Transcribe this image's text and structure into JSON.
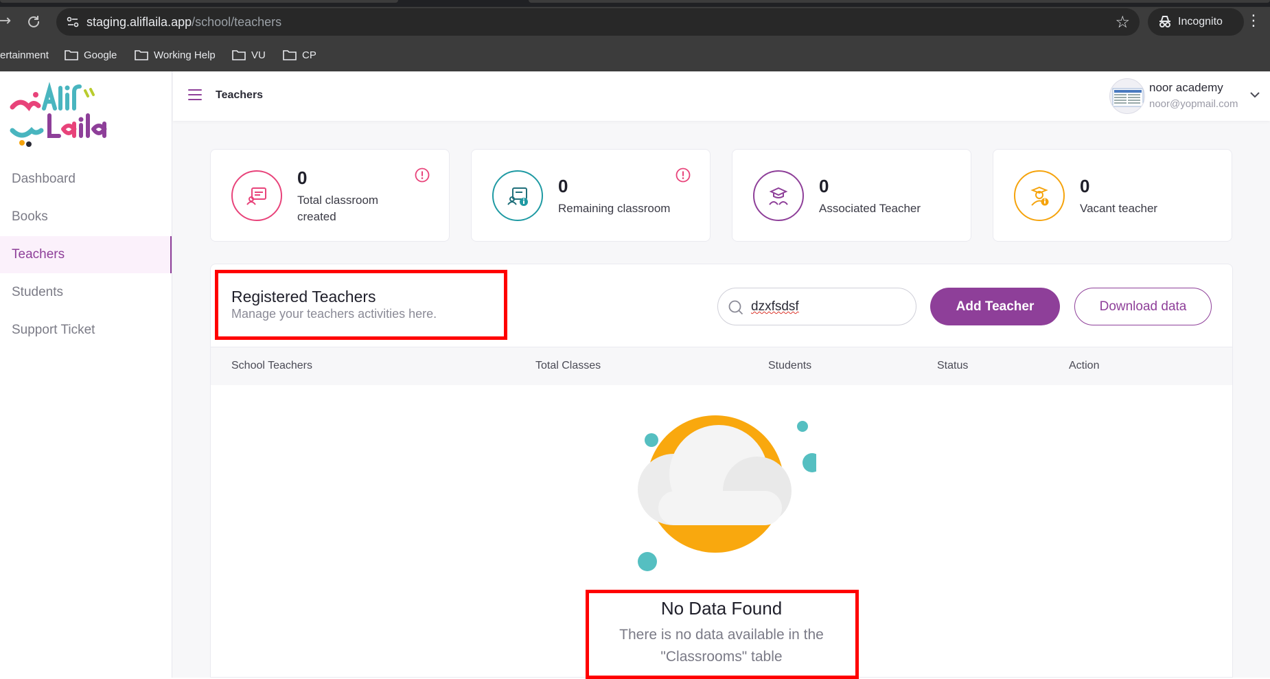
{
  "browser": {
    "url_host": "staging.aliflaila.app",
    "url_path": "/school/teachers",
    "incognito_label": "Incognito",
    "bookmarks": [
      "ertainment",
      "Google",
      "Working Help",
      "VU",
      "CP"
    ]
  },
  "sidebar": {
    "items": [
      {
        "label": "Dashboard",
        "active": false
      },
      {
        "label": "Books",
        "active": false
      },
      {
        "label": "Teachers",
        "active": true
      },
      {
        "label": "Students",
        "active": false
      },
      {
        "label": "Support Ticket",
        "active": false
      }
    ]
  },
  "topbar": {
    "title": "Teachers",
    "profile_name": "noor academy",
    "profile_email": "noor@yopmail.com"
  },
  "stats": [
    {
      "value": "0",
      "label": "Total classroom created",
      "color": "#e8437a"
    },
    {
      "value": "0",
      "label": "Remaining classroom",
      "color": "#1f9aa3"
    },
    {
      "value": "0",
      "label": "Associated Teacher",
      "color": "#8e3f99"
    },
    {
      "value": "0",
      "label": "Vacant teacher",
      "color": "#f5a30c"
    }
  ],
  "panel": {
    "title": "Registered Teachers",
    "subtitle": "Manage your teachers activities here.",
    "search_value": "dzxfsdsf",
    "add_button": "Add Teacher",
    "download_button": "Download data",
    "columns": [
      "School Teachers",
      "Total Classes",
      "Students",
      "Status",
      "Action"
    ],
    "empty_title": "No Data Found",
    "empty_description": "There is no data available in the \"Classrooms\" table"
  },
  "colors": {
    "brand": "#8e3f99",
    "highlight": "#ff0000"
  }
}
